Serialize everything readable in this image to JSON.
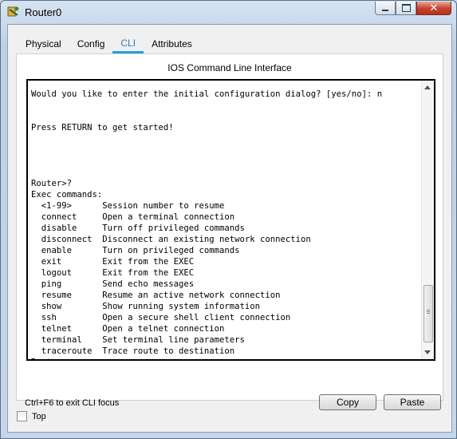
{
  "window": {
    "title": "Router0"
  },
  "tabs": [
    {
      "label": "Physical"
    },
    {
      "label": "Config"
    },
    {
      "label": "CLI"
    },
    {
      "label": "Attributes"
    }
  ],
  "panel": {
    "title": "IOS Command Line Interface"
  },
  "console": {
    "text": "Would you like to enter the initial configuration dialog? [yes/no]: n\n\n\nPress RETURN to get started!\n\n\n\n\nRouter>?\nExec commands:\n  <1-99>      Session number to resume\n  connect     Open a terminal connection\n  disable     Turn off privileged commands\n  disconnect  Disconnect an existing network connection\n  enable      Turn on privileged commands\n  exit        Exit from the EXEC\n  logout      Exit from the EXEC\n  ping        Send echo messages\n  resume      Resume an active network connection\n  show        Show running system information\n  ssh         Open a secure shell client connection\n  telnet      Open a telnet connection\n  terminal    Set terminal line parameters\n  traceroute  Trace route to destination\nRouter>"
  },
  "footer": {
    "hint": "Ctrl+F6 to exit CLI focus",
    "copy_label": "Copy",
    "paste_label": "Paste"
  },
  "bottom": {
    "top_label": "Top",
    "top_checked": false
  },
  "colors": {
    "accent": "#2a9fd8",
    "close_button": "#c4412c"
  }
}
